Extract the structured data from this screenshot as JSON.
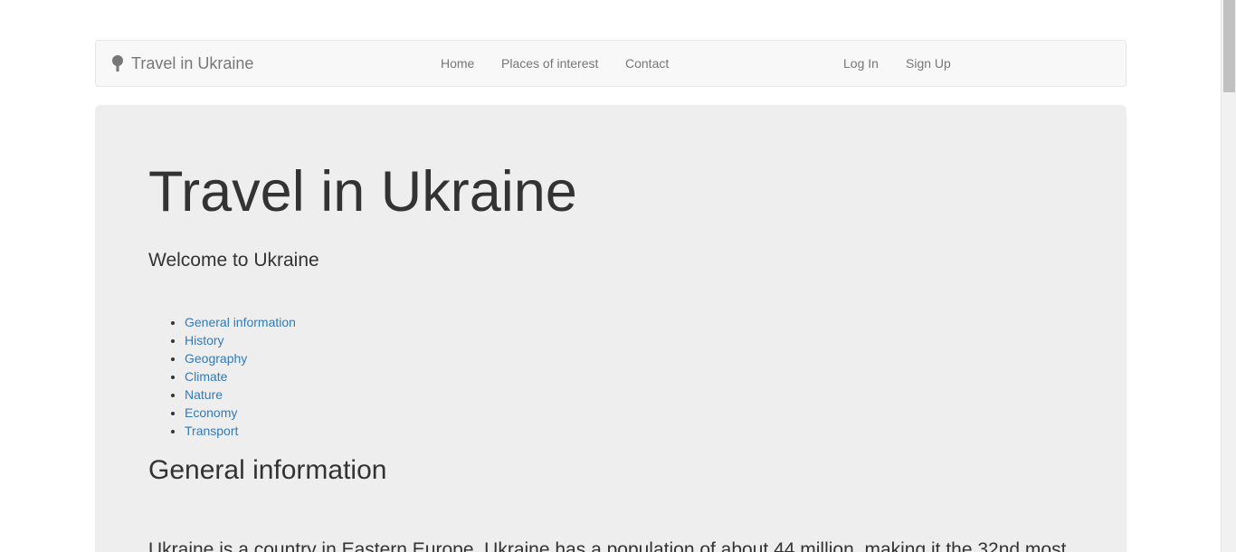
{
  "navbar": {
    "brand": "Travel in Ukraine",
    "brand_icon": "tree-icon",
    "links": [
      {
        "label": "Home"
      },
      {
        "label": "Places of interest"
      },
      {
        "label": "Contact"
      }
    ],
    "auth": [
      {
        "label": "Log In"
      },
      {
        "label": "Sign Up"
      }
    ]
  },
  "hero": {
    "title": "Travel in Ukraine",
    "subtitle": "Welcome to Ukraine"
  },
  "toc": {
    "items": [
      {
        "label": "General information"
      },
      {
        "label": "History"
      },
      {
        "label": "Geography"
      },
      {
        "label": "Climate"
      },
      {
        "label": "Nature"
      },
      {
        "label": "Economy"
      },
      {
        "label": "Transport"
      }
    ]
  },
  "section": {
    "title": "General information",
    "body": "Ukraine is a country in Eastern Europe. Ukraine has a population of about 44 million, making it the 32nd most"
  },
  "colors": {
    "link": "#337ab7",
    "navbar_bg": "#f8f8f8",
    "jumbotron_bg": "#eeeeee",
    "text": "#333333",
    "nav_text": "#777777"
  }
}
